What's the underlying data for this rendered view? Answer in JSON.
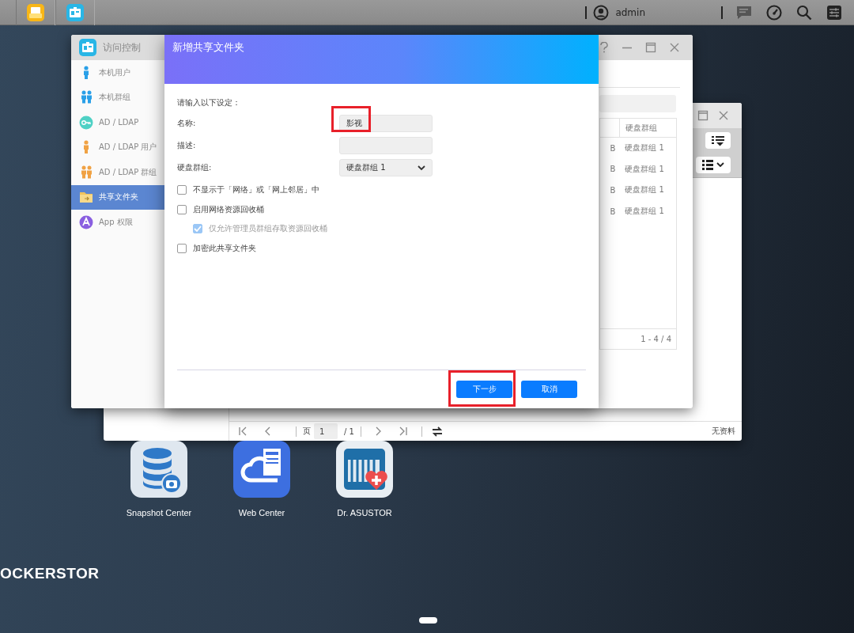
{
  "taskbar": {
    "user": "admin"
  },
  "explorer_window": {
    "pager": {
      "page_label": "页",
      "page": "1",
      "total": "/ 1"
    },
    "status": "无资料"
  },
  "access_window": {
    "title": "访问控制",
    "sidebar": [
      {
        "label": "本机用户",
        "selected": false
      },
      {
        "label": "本机群组",
        "selected": false
      },
      {
        "label": "AD / LDAP",
        "selected": false
      },
      {
        "label": "AD / LDAP 用户",
        "selected": false
      },
      {
        "label": "AD / LDAP 群组",
        "selected": false
      },
      {
        "label": "共享文件夹",
        "selected": true
      },
      {
        "label": "App 权限",
        "selected": false
      }
    ],
    "table": {
      "columns": [
        "硬盘群组"
      ],
      "rows": [
        {
          "column_1": "B",
          "disk_group": "硬盘群组 1"
        },
        {
          "column_1": "B",
          "disk_group": "硬盘群组 1"
        },
        {
          "column_1": "B",
          "disk_group": "硬盘群组 1"
        },
        {
          "column_1": "B",
          "disk_group": "硬盘群组 1"
        }
      ],
      "count": "1 - 4 / 4"
    }
  },
  "dialog": {
    "title": "新增共享文件夹",
    "intro": "请输入以下设定：",
    "fields": [
      {
        "kind": "text",
        "label": "名称:",
        "value": "影视",
        "highlighted": true
      },
      {
        "kind": "text",
        "label": "描述:",
        "highlighted": false
      },
      {
        "kind": "select",
        "label": "硬盘群组:",
        "value": "硬盘群组 1",
        "highlighted": false
      }
    ],
    "options": [
      {
        "label": "不显示于「网络」或「网上邻居」中",
        "checked": false,
        "disabled": false
      },
      {
        "label": "启用网络资源回收桶",
        "checked": false,
        "disabled": false,
        "children": [
          {
            "label": "仅允许管理员群组存取资源回收桶",
            "checked": true,
            "disabled": true
          }
        ]
      },
      {
        "label": "加密此共享文件夹",
        "checked": false,
        "disabled": false
      }
    ],
    "buttons": [
      {
        "label": "下一步",
        "highlighted": true
      },
      {
        "label": "取消",
        "highlighted": false
      }
    ]
  },
  "desktop_icons": [
    {
      "label": "Snapshot Center"
    },
    {
      "label": "Web Center"
    },
    {
      "label": "Dr. ASUSTOR"
    }
  ],
  "logo": "OCKERSTOR"
}
